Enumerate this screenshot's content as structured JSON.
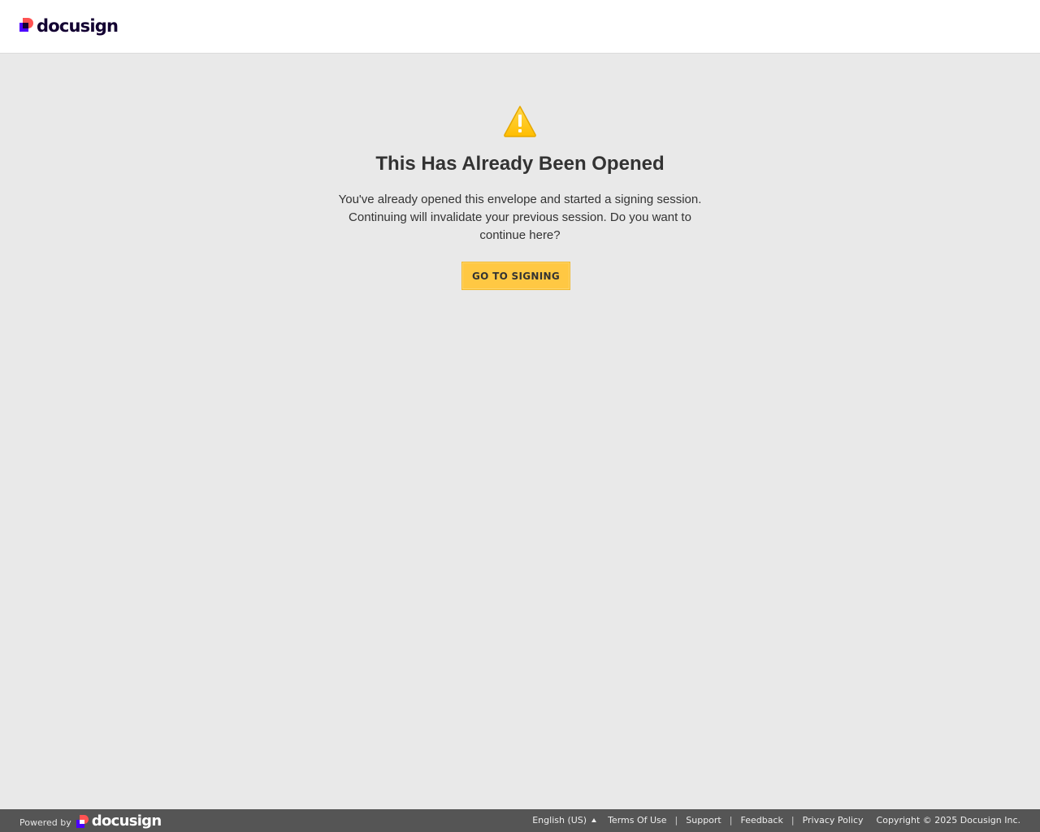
{
  "header": {
    "logo_text": "docusign"
  },
  "main": {
    "title": "This Has Already Been Opened",
    "message": "You've already opened this envelope and started a signing session. Continuing will invalidate your previous session. Do you want to continue here?",
    "button_label": "GO TO SIGNING",
    "icon": "warning-icon"
  },
  "footer": {
    "powered_by": "Powered by",
    "logo_text": "docusign",
    "language": "English (US)",
    "links": {
      "terms": "Terms Of Use",
      "support": "Support",
      "feedback": "Feedback",
      "privacy": "Privacy Policy"
    },
    "separator": "|",
    "copyright": "Copyright © 2025 Docusign Inc."
  },
  "colors": {
    "background": "#e9e9e9",
    "button": "#ffc843",
    "footer": "#555555",
    "brand_red": "#ff5252",
    "brand_purple": "#4c00ff",
    "warning": "#ffc20e"
  }
}
